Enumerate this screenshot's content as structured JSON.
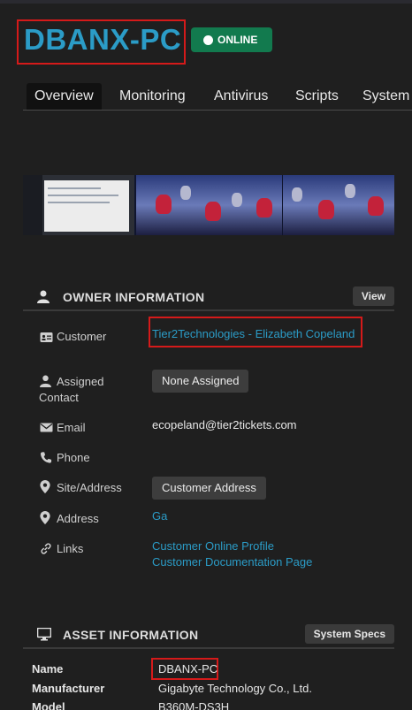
{
  "device": {
    "name": "DBANX-PC",
    "status": "ONLINE",
    "status_color": "#127a4e"
  },
  "tabs": [
    {
      "label": "Overview",
      "active": true
    },
    {
      "label": "Monitoring",
      "active": false
    },
    {
      "label": "Antivirus",
      "active": false
    },
    {
      "label": "Scripts",
      "active": false
    },
    {
      "label": "System",
      "active": false
    }
  ],
  "owner": {
    "section_title": "OWNER INFORMATION",
    "icon": "user-icon",
    "view_label": "View",
    "customer_label": "Customer",
    "customer_value": "Tier2Technologies - Elizabeth Copeland",
    "assigned_label_line1": "Assigned",
    "assigned_label_line2": "Contact",
    "assigned_value": "None Assigned",
    "email_label": "Email",
    "email_value": "ecopeland@tier2tickets.com",
    "phone_label": "Phone",
    "phone_value": "",
    "site_label": "Site/Address",
    "site_value": "Customer Address",
    "address_label": "Address",
    "address_value": "Ga",
    "links_label": "Links",
    "links": [
      "Customer Online Profile",
      "Customer Documentation Page"
    ]
  },
  "asset": {
    "section_title": "ASSET INFORMATION",
    "icon": "monitor-icon",
    "specs_label": "System Specs",
    "rows": [
      {
        "label": "Name",
        "value": "DBANX-PC"
      },
      {
        "label": "Manufacturer",
        "value": "Gigabyte Technology Co., Ltd."
      },
      {
        "label": "Model",
        "value": "B360M-DS3H"
      }
    ]
  },
  "colors": {
    "accent": "#2b9cc7",
    "background": "#1f1f1f",
    "highlight_box": "#d51a1a"
  }
}
